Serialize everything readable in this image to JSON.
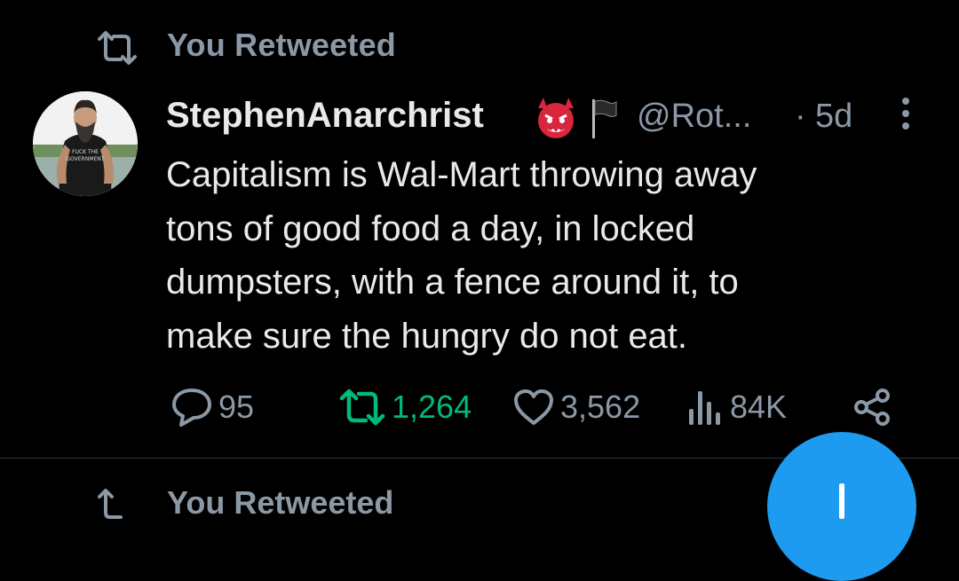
{
  "retweet_header": {
    "label": "You Retweeted",
    "icon": "retweet-icon"
  },
  "tweet": {
    "display_name": "StephenAnarchrist",
    "name_emojis": [
      "devil-face-icon",
      "black-flag-icon"
    ],
    "handle": "@Rot...",
    "separator": "·",
    "time": "5d",
    "text": "Capitalism is Wal-Mart throwing away\ntons of good food a day, in  locked\ndumpsters, with a fence around it, to\nmake sure the hungry do not eat.",
    "avatar": {
      "shirt_text": "FUCK THE GOVERNMENT"
    },
    "actions": {
      "replies": "95",
      "retweets": "1,264",
      "likes": "3,562",
      "views": "84K"
    }
  },
  "next_tweet": {
    "retweet_label": "You Retweeted"
  },
  "colors": {
    "background": "#000000",
    "text_primary": "#e7e9ea",
    "text_secondary": "#8b98a5",
    "retweet_active": "#00ba7c",
    "fab": "#1d9bf0",
    "divider": "#2f3336"
  }
}
